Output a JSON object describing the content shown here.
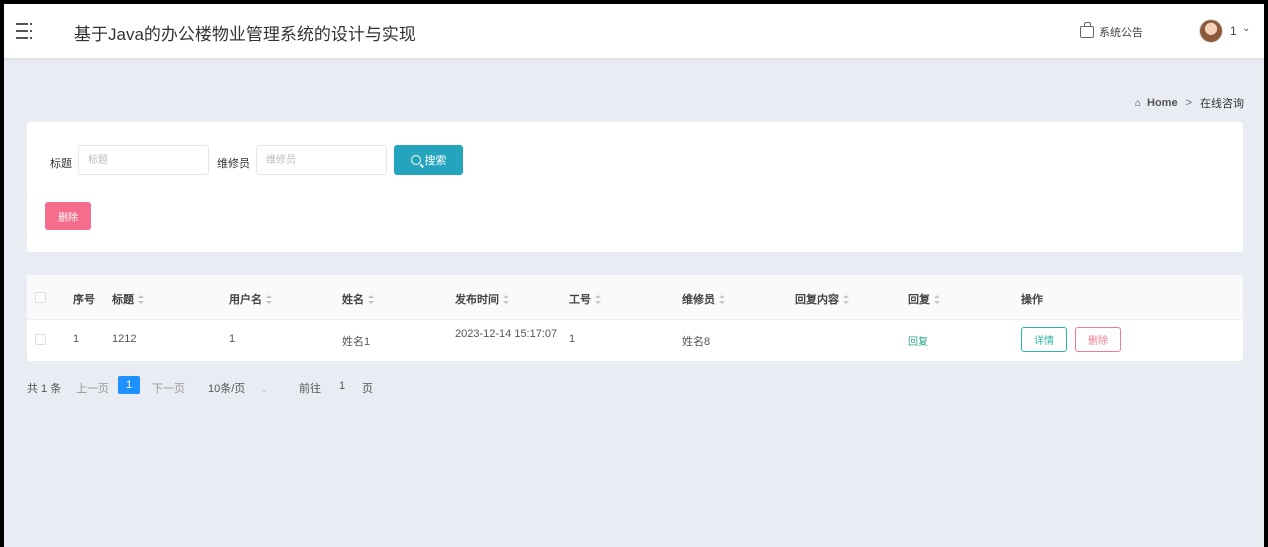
{
  "header": {
    "title": "基于Java的办公楼物业管理系统的设计与实现",
    "notice_label": "系统公告",
    "user_name": "1",
    "caret": "⌄"
  },
  "breadcrumb": {
    "home": "Home",
    "separator": ">",
    "current": "在线咨询"
  },
  "search": {
    "title_label": "标题",
    "title_placeholder": "标题",
    "repairman_label": "维修员",
    "repairman_placeholder": "维修员",
    "search_button": "搜索",
    "delete_button": "删除"
  },
  "table": {
    "columns": [
      "序号",
      "标题",
      "用户名",
      "姓名",
      "发布时间",
      "工号",
      "维修员",
      "回复内容",
      "回复",
      "操作"
    ],
    "rows": [
      {
        "index": "1",
        "title": "1212",
        "username": "1",
        "name": "姓名1",
        "publish_time": "2023-12-14 15:17:07",
        "job_no": "1",
        "repairman": "姓名8",
        "reply_content": "",
        "reply": "回复",
        "detail_button": "详情",
        "delete_button": "删除"
      }
    ]
  },
  "pagination": {
    "total": "共 1 条",
    "prev": "上一页",
    "current_page": "1",
    "next": "下一页",
    "page_size": "10条/页",
    "goto_label": "前往",
    "goto_value": "1",
    "page_suffix": "页"
  }
}
